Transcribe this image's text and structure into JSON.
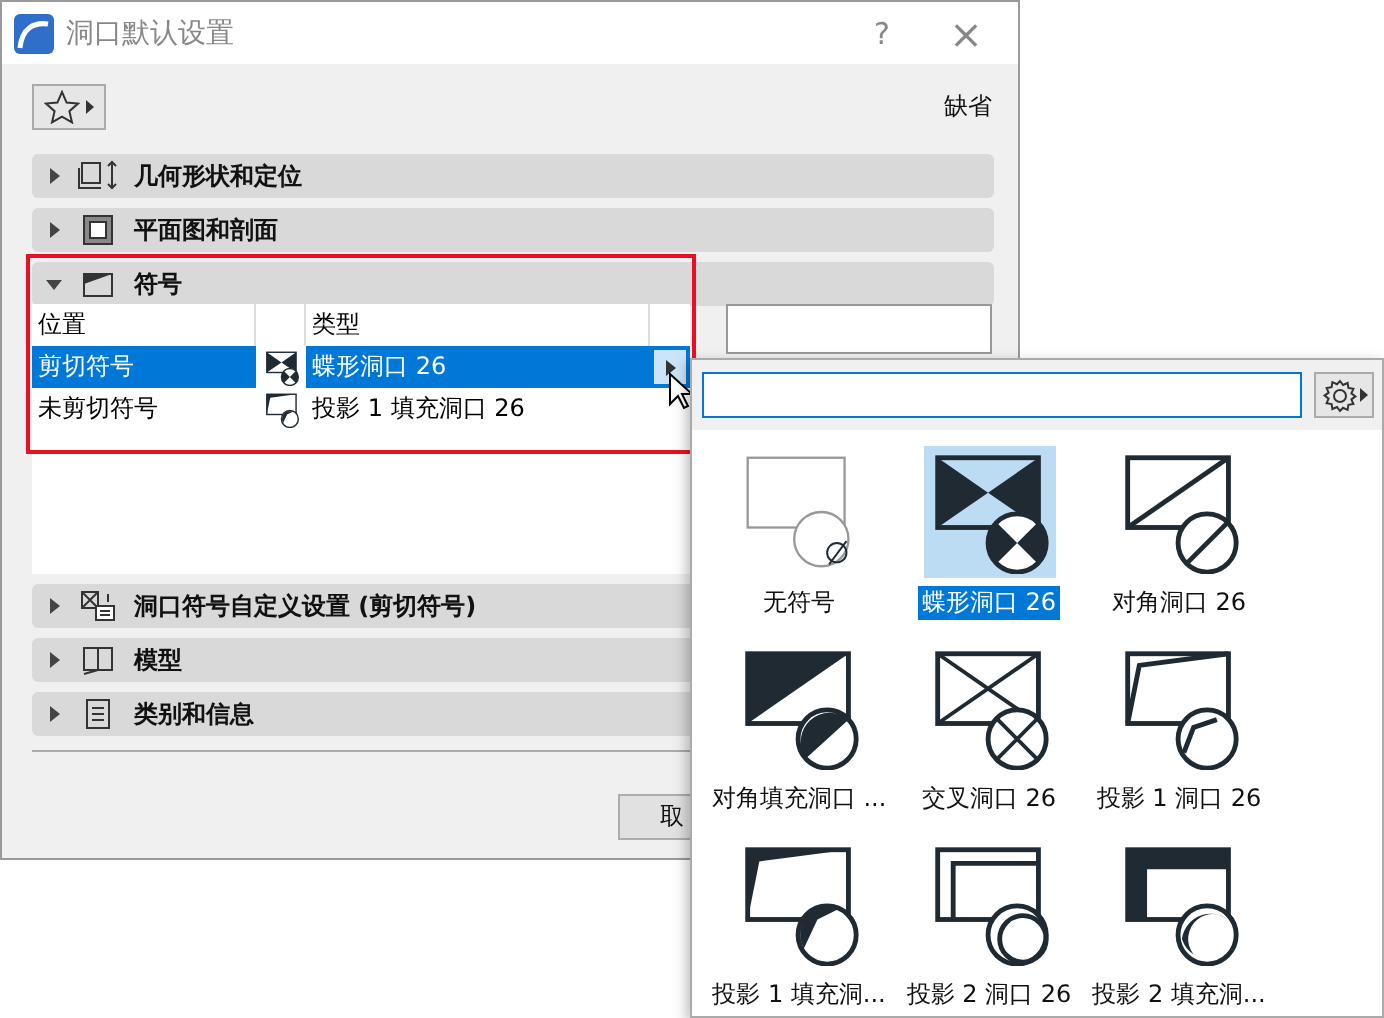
{
  "window": {
    "title": "洞口默认设置",
    "help": "?",
    "close": "×"
  },
  "default_label": "缺省",
  "sections": [
    {
      "label": "几何形状和定位",
      "expanded": false
    },
    {
      "label": "平面图和剖面",
      "expanded": false
    },
    {
      "label": "符号",
      "expanded": true
    },
    {
      "label": "洞口符号自定义设置 (剪切符号)",
      "expanded": false
    },
    {
      "label": "模型",
      "expanded": false
    },
    {
      "label": "类别和信息",
      "expanded": false
    }
  ],
  "symbol_table": {
    "columns": {
      "position": "位置",
      "type": "类型"
    },
    "rows": [
      {
        "position": "剪切符号",
        "type": "蝶形洞口 26",
        "selected": true
      },
      {
        "position": "未剪切符号",
        "type": "投影 1 填充洞口 26",
        "selected": false
      }
    ]
  },
  "buttons": [
    {
      "label": "取"
    }
  ],
  "symbol_picker": {
    "options": [
      {
        "label": "无符号",
        "selected": false
      },
      {
        "label": "蝶形洞口 26",
        "selected": true
      },
      {
        "label": "对角洞口 26",
        "selected": false
      },
      {
        "label": "对角填充洞口 ...",
        "selected": false
      },
      {
        "label": "交叉洞口 26",
        "selected": false
      },
      {
        "label": "投影 1 洞口 26",
        "selected": false
      },
      {
        "label": "投影 1 填充洞...",
        "selected": false
      },
      {
        "label": "投影 2 洞口 26",
        "selected": false
      },
      {
        "label": "投影 2 填充洞...",
        "selected": false
      }
    ]
  }
}
